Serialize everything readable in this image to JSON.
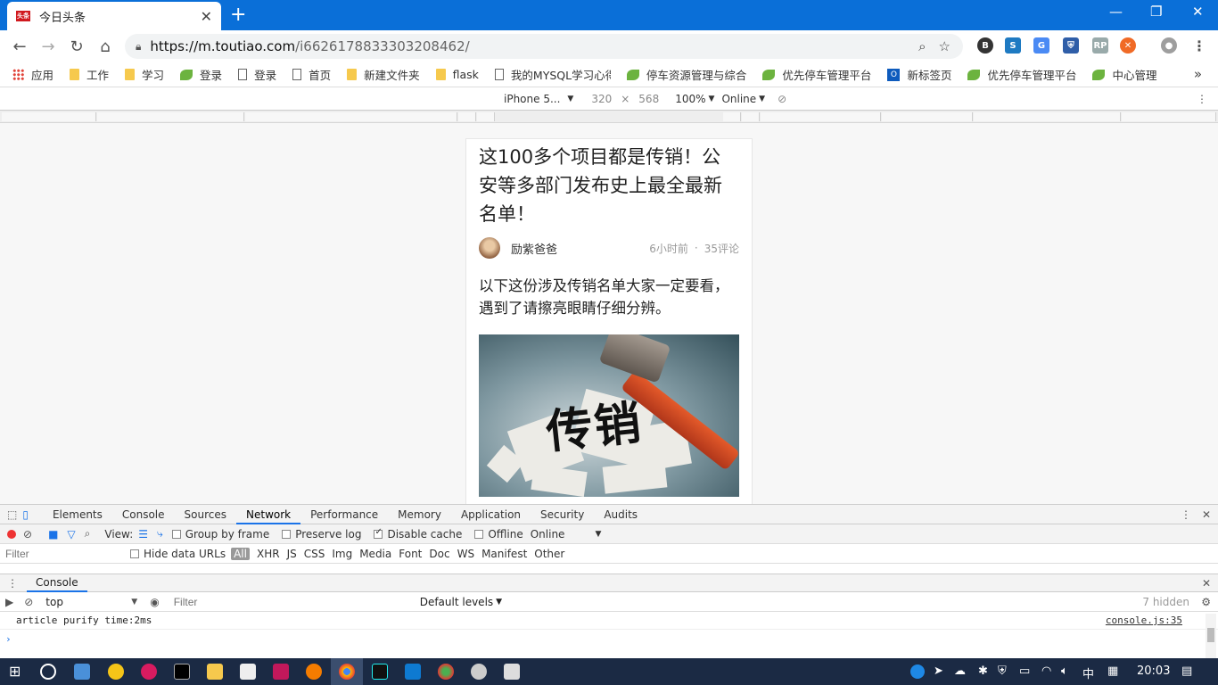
{
  "browser": {
    "tab_title": "今日头条",
    "favicon_text": "头条",
    "url_host": "https://m.toutiao.com",
    "url_path": "/i6626178833303208462/"
  },
  "bookmarks": [
    {
      "label": "应用",
      "icon": "apps"
    },
    {
      "label": "工作",
      "icon": "folder"
    },
    {
      "label": "学习",
      "icon": "folder"
    },
    {
      "label": "登录",
      "icon": "leaf"
    },
    {
      "label": "登录",
      "icon": "page"
    },
    {
      "label": "首页",
      "icon": "page"
    },
    {
      "label": "新建文件夹",
      "icon": "folder"
    },
    {
      "label": "flask",
      "icon": "folder"
    },
    {
      "label": "我的MYSQL学习心得",
      "icon": "page"
    },
    {
      "label": "停车资源管理与综合",
      "icon": "leaf"
    },
    {
      "label": "优先停车管理平台",
      "icon": "leaf"
    },
    {
      "label": "新标签页",
      "icon": "outlook"
    },
    {
      "label": "优先停车管理平台",
      "icon": "leaf"
    },
    {
      "label": "中心管理",
      "icon": "leaf"
    }
  ],
  "device_toolbar": {
    "device": "iPhone 5...",
    "width": "320",
    "times": "×",
    "height": "568",
    "zoom": "100%",
    "network": "Online"
  },
  "article": {
    "title": "这100多个项目都是传销！公安等多部门发布史上最全最新名单！",
    "author": "励紫爸爸",
    "time": "6小时前",
    "dot": "·",
    "comments": "35评论",
    "intro": "以下这份涉及传销名单大家一定要看，遇到了请擦亮眼睛仔细分辨。",
    "image_text": "传销"
  },
  "devtools": {
    "tabs": [
      "Elements",
      "Console",
      "Sources",
      "Network",
      "Performance",
      "Memory",
      "Application",
      "Security",
      "Audits"
    ],
    "active_tab": "Network",
    "view_label": "View:",
    "group_by_frame": "Group by frame",
    "preserve_log": "Preserve log",
    "disable_cache": "Disable cache",
    "offline": "Offline",
    "online": "Online",
    "filter_placeholder": "Filter",
    "hide_data_urls": "Hide data URLs",
    "types": [
      "All",
      "XHR",
      "JS",
      "CSS",
      "Img",
      "Media",
      "Font",
      "Doc",
      "WS",
      "Manifest",
      "Other"
    ],
    "console_tab": "Console",
    "context": "top",
    "console_filter_placeholder": "Filter",
    "levels": "Default levels",
    "hidden": "7 hidden",
    "log_message": "article purify time:2ms",
    "log_source": "console.js:35",
    "prompt": "›"
  },
  "taskbar": {
    "ime": "中",
    "clock": "20:03"
  }
}
